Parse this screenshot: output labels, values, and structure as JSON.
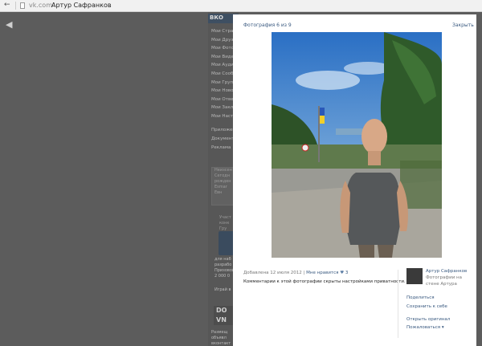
{
  "browser": {
    "back_icon": "back-arrow-icon",
    "host": "vk.com",
    "title": "Артур Сафранков"
  },
  "background_page": {
    "logo": "ВКО",
    "menu": [
      "Мои Стра",
      "Мои Друзья",
      "Мои Фото",
      "Мои Виде",
      "Мои Ауди",
      "Мои Сооб",
      "Мои Групп",
      "Мои Ново",
      "Мои Отве",
      "Мои Закл",
      "Мои Наст"
    ],
    "menu2": [
      "Приложен",
      "Документ",
      "Реклама"
    ],
    "box": [
      "Неизсен",
      "Сегодн",
      "рожден",
      "Esmar",
      "Евн"
    ],
    "block": [
      "Участ",
      "конк",
      "Гру"
    ],
    "text2": [
      "для наб",
      "разрабо",
      "Призовой",
      "2 000 0"
    ],
    "text3": [
      "Играй в"
    ],
    "dom": "DO",
    "dom2": "VN",
    "text4": [
      "Размещ",
      "объявл",
      "вконтакт",
      "на странице"
    ]
  },
  "popup": {
    "header": "Фотография 6 из 9",
    "close": "Закрыть",
    "meta_added": "Добавлена 12 июля 2012",
    "meta_sep": "|",
    "like_label": "Мне нравится",
    "heart": "♥",
    "like_count": "3",
    "privacy_note": "Комментарии к этой фотографии скрыты настройками приватности.",
    "author_name": "Артур Сафранков",
    "author_sub": "Фотографии на стене Артура",
    "actions": {
      "share": "Поделиться",
      "save": "Сохранить к себе",
      "open_original": "Открыть оригинал",
      "report": "Пожаловаться ▾"
    }
  }
}
